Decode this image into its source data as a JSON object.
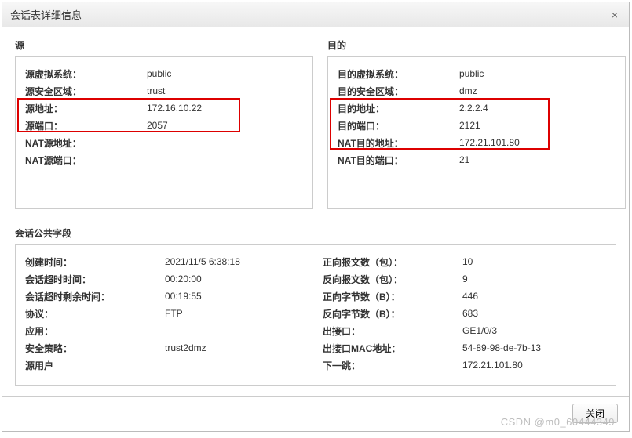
{
  "dialog": {
    "title": "会话表详细信息"
  },
  "source": {
    "title": "源",
    "rows": {
      "vsys": {
        "label": "源虚拟系统：",
        "value": "public"
      },
      "zone": {
        "label": "源安全区域：",
        "value": "trust"
      },
      "addr": {
        "label": "源地址：",
        "value": "172.16.10.22"
      },
      "port": {
        "label": "源端口：",
        "value": "2057"
      },
      "nat_addr": {
        "label": "NAT源地址：",
        "value": ""
      },
      "nat_port": {
        "label": "NAT源端口：",
        "value": ""
      }
    }
  },
  "dest": {
    "title": "目的",
    "rows": {
      "vsys": {
        "label": "目的虚拟系统：",
        "value": "public"
      },
      "zone": {
        "label": "目的安全区域：",
        "value": "dmz"
      },
      "addr": {
        "label": "目的地址：",
        "value": "2.2.2.4"
      },
      "port": {
        "label": "目的端口：",
        "value": "2121"
      },
      "nat_addr": {
        "label": "NAT目的地址：",
        "value": "172.21.101.80"
      },
      "nat_port": {
        "label": "NAT目的端口：",
        "value": "21"
      }
    }
  },
  "public": {
    "title": "会话公共字段",
    "left": {
      "created": {
        "label": "创建时间：",
        "value": "2021/11/5 6:38:18"
      },
      "timeout": {
        "label": "会话超时时间：",
        "value": "00:20:00"
      },
      "remain": {
        "label": "会话超时剩余时间：",
        "value": "00:19:55"
      },
      "proto": {
        "label": "协议：",
        "value": "FTP"
      },
      "app": {
        "label": "应用：",
        "value": ""
      },
      "policy": {
        "label": "安全策略：",
        "value": "trust2dmz"
      },
      "user": {
        "label": "源用户",
        "value": ""
      }
    },
    "right": {
      "fwd_pkts": {
        "label": "正向报文数（包）：",
        "value": "10"
      },
      "rev_pkts": {
        "label": "反向报文数（包）：",
        "value": "9"
      },
      "fwd_bytes": {
        "label": "正向字节数（B）：",
        "value": "446"
      },
      "rev_bytes": {
        "label": "反向字节数（B）：",
        "value": "683"
      },
      "out_if": {
        "label": "出接口：",
        "value": "GE1/0/3"
      },
      "out_mac": {
        "label": "出接口MAC地址：",
        "value": "54-89-98-de-7b-13"
      },
      "next_hop": {
        "label": "下一跳：",
        "value": "172.21.101.80"
      }
    }
  },
  "footer": {
    "close": "关闭"
  },
  "watermark": "CSDN @m0_60444349"
}
